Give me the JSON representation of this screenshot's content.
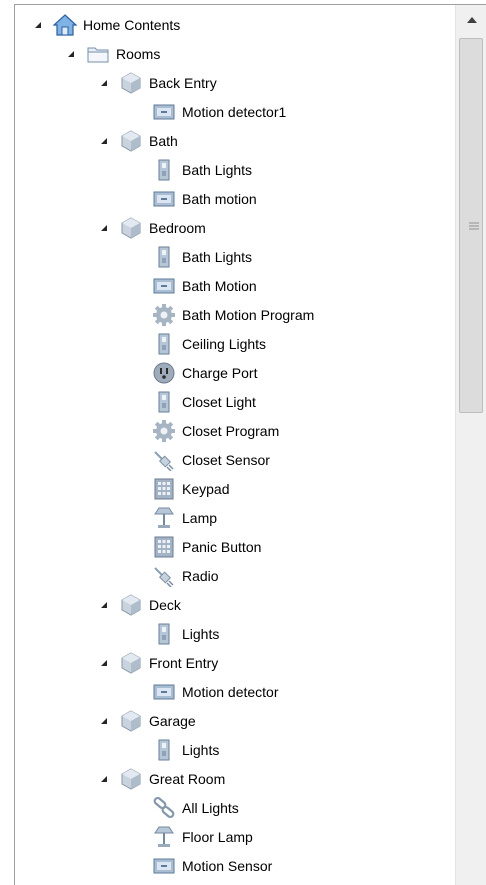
{
  "tree": {
    "items": [
      {
        "label": "Home Contents",
        "level": 0,
        "icon": "house",
        "expanded": true
      },
      {
        "label": "Rooms",
        "level": 1,
        "icon": "folder",
        "expanded": true
      },
      {
        "label": "Back Entry",
        "level": 2,
        "icon": "room",
        "expanded": true
      },
      {
        "label": "Motion detector1",
        "level": 3,
        "icon": "motion"
      },
      {
        "label": "Bath",
        "level": 2,
        "icon": "room",
        "expanded": true
      },
      {
        "label": "Bath Lights",
        "level": 3,
        "icon": "switch"
      },
      {
        "label": "Bath motion",
        "level": 3,
        "icon": "motion"
      },
      {
        "label": "Bedroom",
        "level": 2,
        "icon": "room",
        "expanded": true
      },
      {
        "label": "Bath Lights",
        "level": 3,
        "icon": "switch"
      },
      {
        "label": "Bath Motion",
        "level": 3,
        "icon": "motion"
      },
      {
        "label": "Bath Motion Program",
        "level": 3,
        "icon": "gear"
      },
      {
        "label": "Ceiling Lights",
        "level": 3,
        "icon": "switch"
      },
      {
        "label": "Charge Port",
        "level": 3,
        "icon": "outlet"
      },
      {
        "label": "Closet Light",
        "level": 3,
        "icon": "switch"
      },
      {
        "label": "Closet Program",
        "level": 3,
        "icon": "gear"
      },
      {
        "label": "Closet Sensor",
        "level": 3,
        "icon": "plug"
      },
      {
        "label": "Keypad",
        "level": 3,
        "icon": "keypad"
      },
      {
        "label": "Lamp",
        "level": 3,
        "icon": "lamp"
      },
      {
        "label": "Panic Button",
        "level": 3,
        "icon": "keypad"
      },
      {
        "label": "Radio",
        "level": 3,
        "icon": "plug"
      },
      {
        "label": "Deck",
        "level": 2,
        "icon": "room",
        "expanded": true
      },
      {
        "label": "Lights",
        "level": 3,
        "icon": "switch"
      },
      {
        "label": "Front Entry",
        "level": 2,
        "icon": "room",
        "expanded": true
      },
      {
        "label": "Motion detector",
        "level": 3,
        "icon": "motion"
      },
      {
        "label": "Garage",
        "level": 2,
        "icon": "room",
        "expanded": true
      },
      {
        "label": "Lights",
        "level": 3,
        "icon": "switch"
      },
      {
        "label": "Great Room",
        "level": 2,
        "icon": "room",
        "expanded": true
      },
      {
        "label": "All Lights",
        "level": 3,
        "icon": "link"
      },
      {
        "label": "Floor Lamp",
        "level": 3,
        "icon": "lamp"
      },
      {
        "label": "Motion Sensor",
        "level": 3,
        "icon": "motion"
      }
    ]
  },
  "scrollbar": {
    "up_icon": "triangle-up",
    "grip_icon": "grip-lines"
  }
}
